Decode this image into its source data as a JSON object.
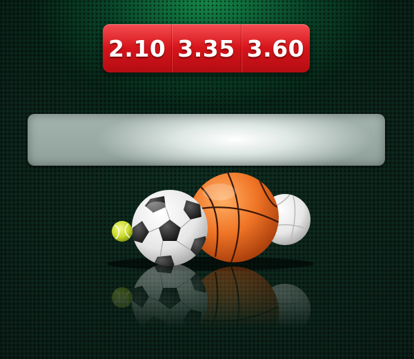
{
  "odds": {
    "home": "2.10",
    "draw": "3.35",
    "away": "3.60"
  },
  "colors": {
    "odds_red": "#d8151b",
    "background_green": "#0d2a1e",
    "basketball_orange": "#e8651a"
  },
  "icons": [
    "tennis-ball-icon",
    "soccer-ball-icon",
    "basketball-icon",
    "volleyball-icon"
  ]
}
